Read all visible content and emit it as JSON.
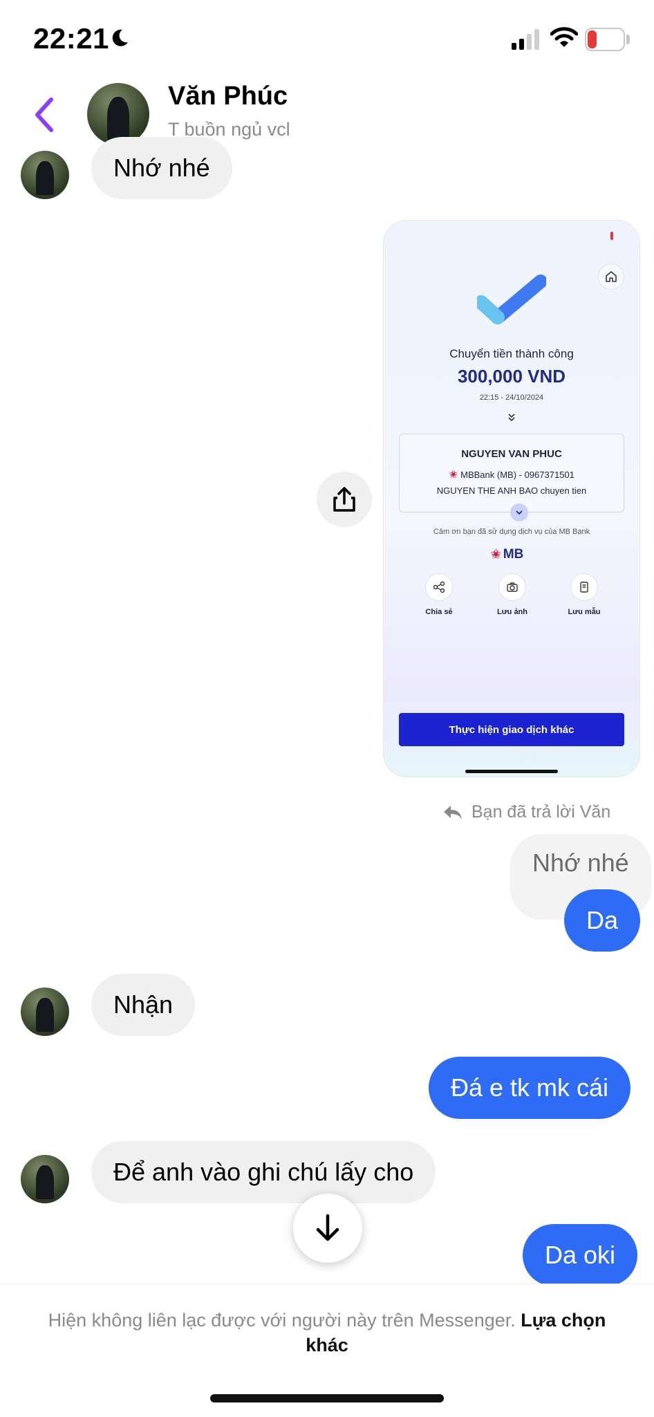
{
  "status_bar": {
    "time": "22:21",
    "battery": "15"
  },
  "header": {
    "name": "Văn Phúc",
    "status": "T buồn ngủ vcl"
  },
  "messages": {
    "m1": "Nhớ nhé",
    "reply_note": "Bạn đã trả lời Văn",
    "quoted": "Nhớ nhé",
    "m2": "Da",
    "m3": "Nhận",
    "m4": "Đá e tk mk cái",
    "m5": "Để anh vào ghi chú lấy cho",
    "m6": "Da oki"
  },
  "shared_screenshot": {
    "title": "Chuyển tiền thành công",
    "amount": "300,000 VND",
    "time": "22:15 - 24/10/2024",
    "recipient": "NGUYEN VAN PHUC",
    "bank": "MBBank (MB) - 0967371501",
    "note": "NGUYEN THE ANH BAO chuyen tien",
    "thanks": "Cảm ơn bạn đã sử dụng dịch vụ của MB Bank",
    "logo": "MB",
    "actions": [
      "Chia sẻ",
      "Lưu ảnh",
      "Lưu mẫu"
    ],
    "cta": "Thực hiện giao dịch khác"
  },
  "footer": {
    "notice": "Hiện không liên lạc được với người này trên Messenger.",
    "link": "Lựa chọn khác"
  },
  "colors": {
    "accent": "#2f6cf5",
    "back_arrow": "#8a3ffc",
    "bank_blue": "#1b23d1"
  }
}
